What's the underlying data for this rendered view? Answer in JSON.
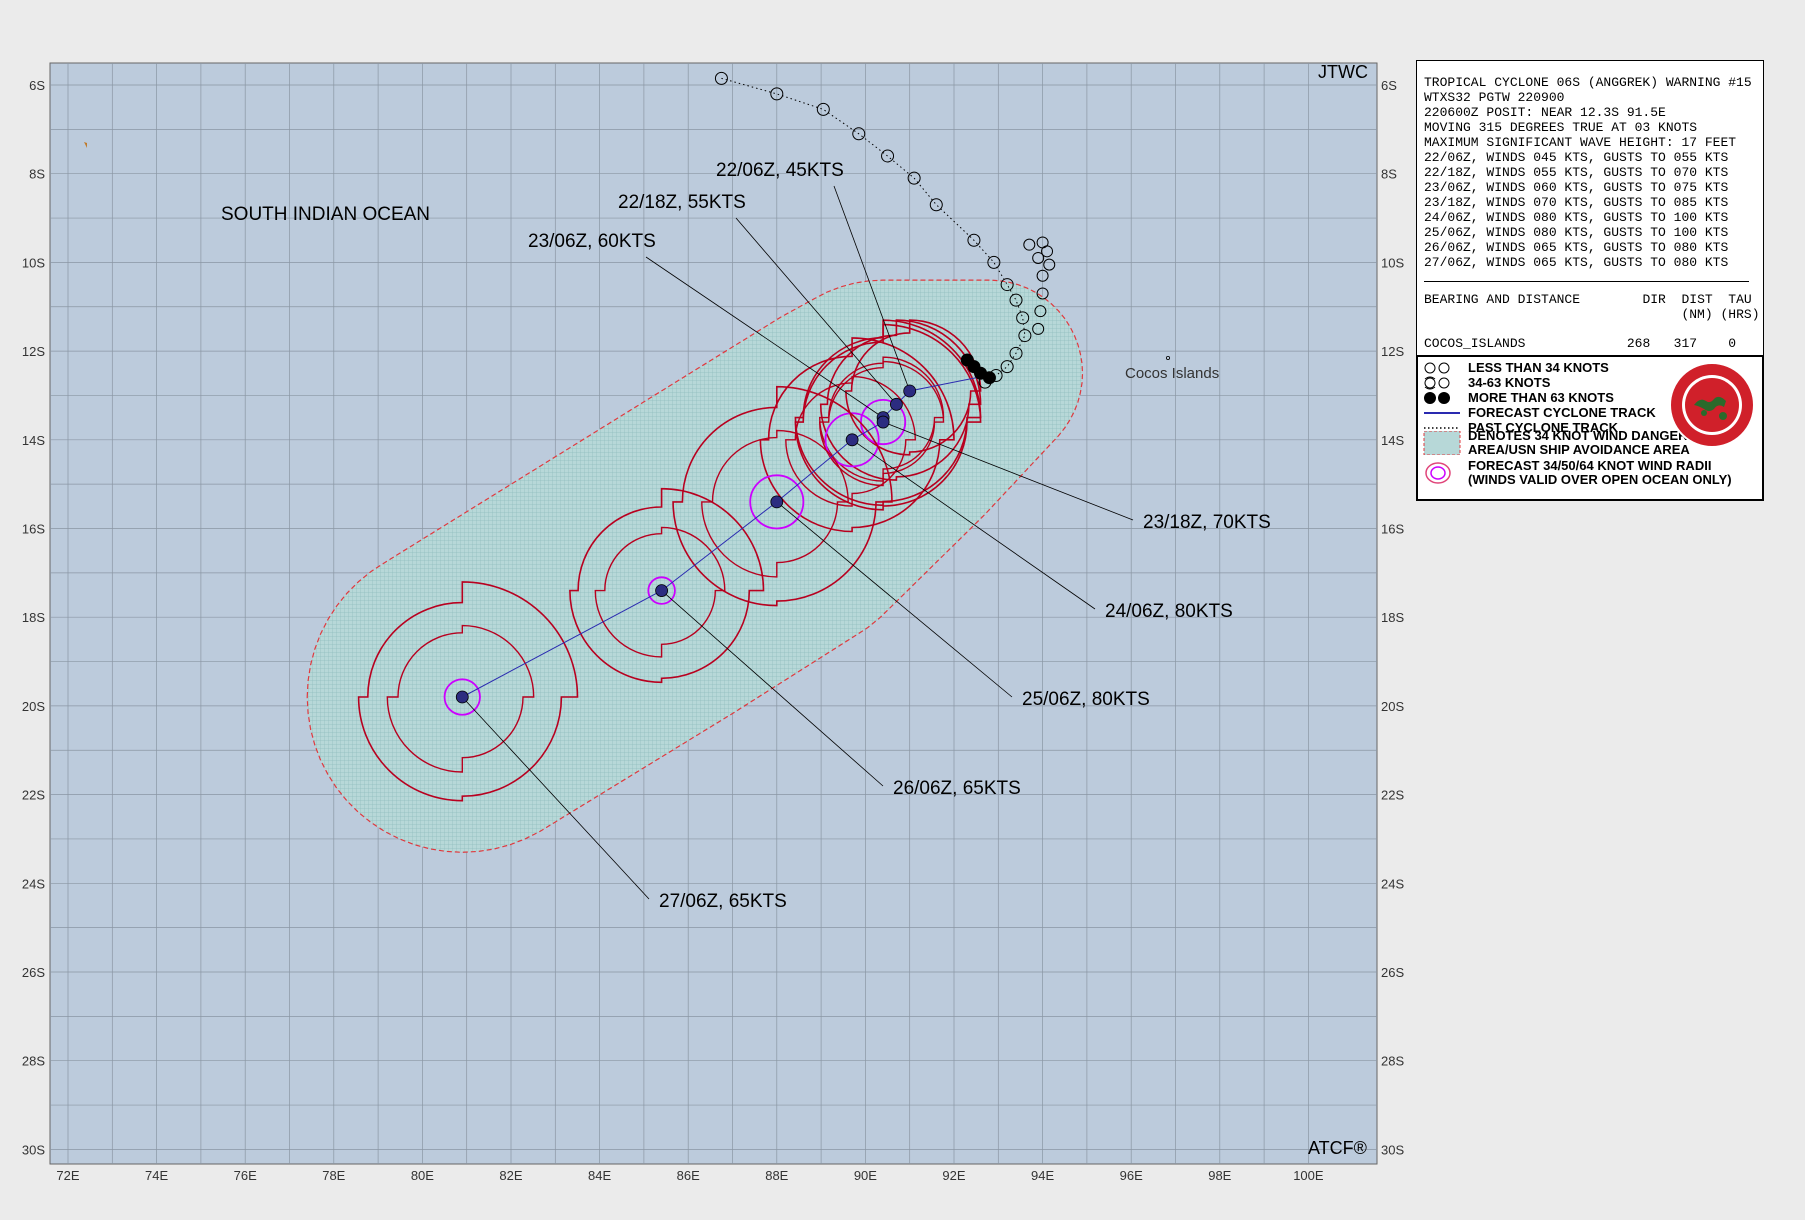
{
  "map": {
    "agency": "JTWC",
    "software": "ATCF®",
    "region_label": "SOUTH INDIAN OCEAN",
    "place_label": "Cocos Islands",
    "lat_labels": [
      "6S",
      "8S",
      "10S",
      "12S",
      "14S",
      "16S",
      "18S",
      "20S",
      "22S",
      "24S",
      "26S",
      "28S",
      "30S"
    ],
    "lon_labels": [
      "72E",
      "74E",
      "76E",
      "78E",
      "80E",
      "82E",
      "84E",
      "86E",
      "88E",
      "90E",
      "92E",
      "94E",
      "96E",
      "98E",
      "100E"
    ],
    "lat_range": [
      -6,
      -30
    ],
    "lon_range": [
      72,
      100
    ],
    "colors": {
      "ocean": "#bccbdc",
      "danger_area": "#b7d8d8",
      "danger_outline": "#e0393e",
      "radii_34": "#b8001f",
      "radii_64": "#cc00ff",
      "track": "#2a2ab0",
      "center": "#2c2c80"
    },
    "past_track": [
      {
        "lat": -5.85,
        "lon": 86.75
      },
      {
        "lat": -6.2,
        "lon": 88.0
      },
      {
        "lat": -6.55,
        "lon": 89.05
      },
      {
        "lat": -7.1,
        "lon": 89.85
      },
      {
        "lat": -7.6,
        "lon": 90.5
      },
      {
        "lat": -8.1,
        "lon": 91.1
      },
      {
        "lat": -8.7,
        "lon": 91.6
      },
      {
        "lat": -9.5,
        "lon": 92.45
      },
      {
        "lat": -10.0,
        "lon": 92.9
      },
      {
        "lat": -10.5,
        "lon": 93.2
      },
      {
        "lat": -10.85,
        "lon": 93.4
      },
      {
        "lat": -11.25,
        "lon": 93.55
      },
      {
        "lat": -11.65,
        "lon": 93.6
      },
      {
        "lat": -12.05,
        "lon": 93.4
      },
      {
        "lat": -12.35,
        "lon": 93.2
      },
      {
        "lat": -12.55,
        "lon": 92.95
      },
      {
        "lat": -12.7,
        "lon": 92.7
      }
    ],
    "forecast_points": [
      {
        "label": "22/06Z,  45KTS",
        "lat": -12.9,
        "lon": 91.0,
        "r34": 1.6,
        "r64": 0.0
      },
      {
        "label": "22/18Z,  55KTS",
        "lat": -13.2,
        "lon": 90.7,
        "r34": 1.9,
        "r64": 0.0
      },
      {
        "label": "23/06Z,  60KTS",
        "lat": -13.5,
        "lon": 90.4,
        "r34": 2.2,
        "r64": 0.0
      },
      {
        "label": "23/18Z,  70KTS",
        "lat": -13.6,
        "lon": 90.4,
        "r34": 2.2,
        "r64": 0.5
      },
      {
        "label": "24/06Z,  80KTS",
        "lat": -14.0,
        "lon": 89.7,
        "r34": 2.3,
        "r64": 0.6
      },
      {
        "label": "25/06Z,  80KTS",
        "lat": -15.4,
        "lon": 88.0,
        "r34": 2.6,
        "r64": 0.6
      },
      {
        "label": "26/06Z,  65KTS",
        "lat": -17.4,
        "lon": 85.4,
        "r34": 2.3,
        "r64": 0.3
      },
      {
        "label": "27/06Z,  65KTS",
        "lat": -19.8,
        "lon": 80.9,
        "r34": 2.6,
        "r64": 0.4
      }
    ]
  },
  "warning": {
    "lines": [
      "TROPICAL CYCLONE 06S (ANGGREK) WARNING #15",
      "WTXS32 PGTW 220900",
      "220600Z POSIT: NEAR 12.3S 91.5E",
      "MOVING 315 DEGREES TRUE AT 03 KNOTS",
      "MAXIMUM SIGNIFICANT WAVE HEIGHT: 17 FEET",
      "22/06Z, WINDS 045 KTS, GUSTS TO 055 KTS",
      "22/18Z, WINDS 055 KTS, GUSTS TO 070 KTS",
      "23/06Z, WINDS 060 KTS, GUSTS TO 075 KTS",
      "23/18Z, WINDS 070 KTS, GUSTS TO 085 KTS",
      "24/06Z, WINDS 080 KTS, GUSTS TO 100 KTS",
      "25/06Z, WINDS 080 KTS, GUSTS TO 100 KTS",
      "26/06Z, WINDS 065 KTS, GUSTS TO 080 KTS",
      "27/06Z, WINDS 065 KTS, GUSTS TO 080 KTS"
    ],
    "bearing_header": "BEARING AND DISTANCE",
    "col_dir": "DIR",
    "col_dist": "DIST",
    "col_tau": "TAU",
    "col_dist_unit": "(NM)",
    "col_tau_unit": "(HRS)",
    "station": "COCOS_ISLANDS",
    "dir": "268",
    "dist": "317",
    "tau": "0"
  },
  "legend": {
    "items": [
      {
        "icon": "less-than-34-icon",
        "text": "LESS THAN 34 KNOTS"
      },
      {
        "icon": "34-63-knots-icon",
        "text": "34-63 KNOTS"
      },
      {
        "icon": "more-than-63-icon",
        "text": "MORE THAN 63 KNOTS"
      },
      {
        "icon": "forecast-track-icon",
        "text": "FORECAST CYCLONE TRACK"
      },
      {
        "icon": "past-track-icon",
        "text": "PAST CYCLONE TRACK"
      },
      {
        "icon": "danger-area-icon",
        "text": "DENOTES 34 KNOT WIND DANGER AREA/USN SHIP AVOIDANCE AREA"
      },
      {
        "icon": "wind-radii-icon",
        "text": "FORECAST 34/50/64 KNOT WIND RADII (WINDS VALID OVER OPEN OCEAN ONLY)"
      }
    ],
    "item_lines": [
      [
        "LESS THAN 34 KNOTS"
      ],
      [
        "34-63 KNOTS"
      ],
      [
        "MORE THAN 63 KNOTS"
      ],
      [
        "FORECAST CYCLONE TRACK"
      ],
      [
        "PAST CYCLONE TRACK"
      ],
      [
        "DENOTES 34 KNOT WIND DANGER",
        "AREA/USN SHIP AVOIDANCE AREA"
      ],
      [
        "FORECAST 34/50/64 KNOT WIND RADII",
        " (WINDS VALID OVER OPEN OCEAN ONLY)"
      ]
    ]
  }
}
